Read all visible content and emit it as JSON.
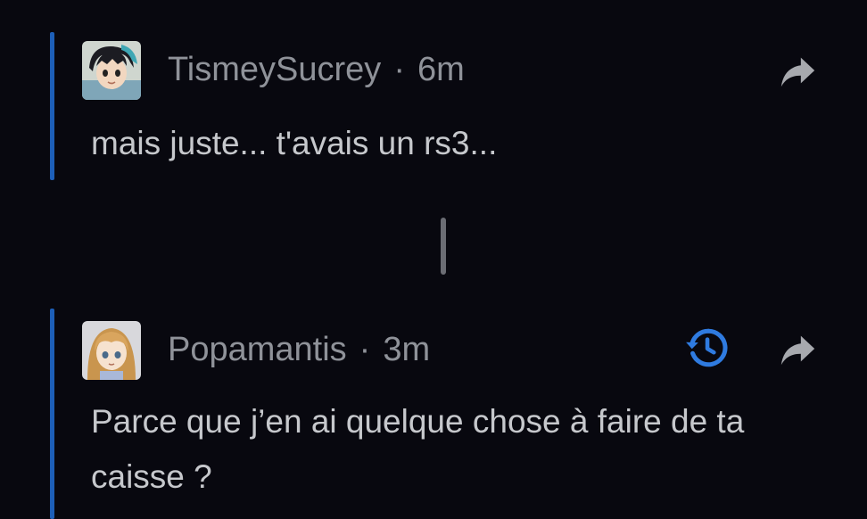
{
  "comments": [
    {
      "username": "TismeySucrey",
      "separator": "·",
      "time": "6m",
      "text": "mais juste... t'avais un rs3...",
      "avatar_icon": "anime-avatar-dark-hair",
      "actions": [
        "share-icon"
      ]
    },
    {
      "username": "Popamantis",
      "separator": "·",
      "time": "3m",
      "text": "Parce que j’en ai quelque chose à faire de ta caisse ?",
      "avatar_icon": "anime-avatar-blonde-hair",
      "actions": [
        "history-icon",
        "share-icon"
      ]
    }
  ],
  "colors": {
    "background": "#08080f",
    "accent_bar": "#1d5fb8",
    "history_icon": "#2f7be0",
    "share_icon": "#a7a9ae",
    "username": "#8f9299",
    "body_text": "#c6c8cc"
  }
}
